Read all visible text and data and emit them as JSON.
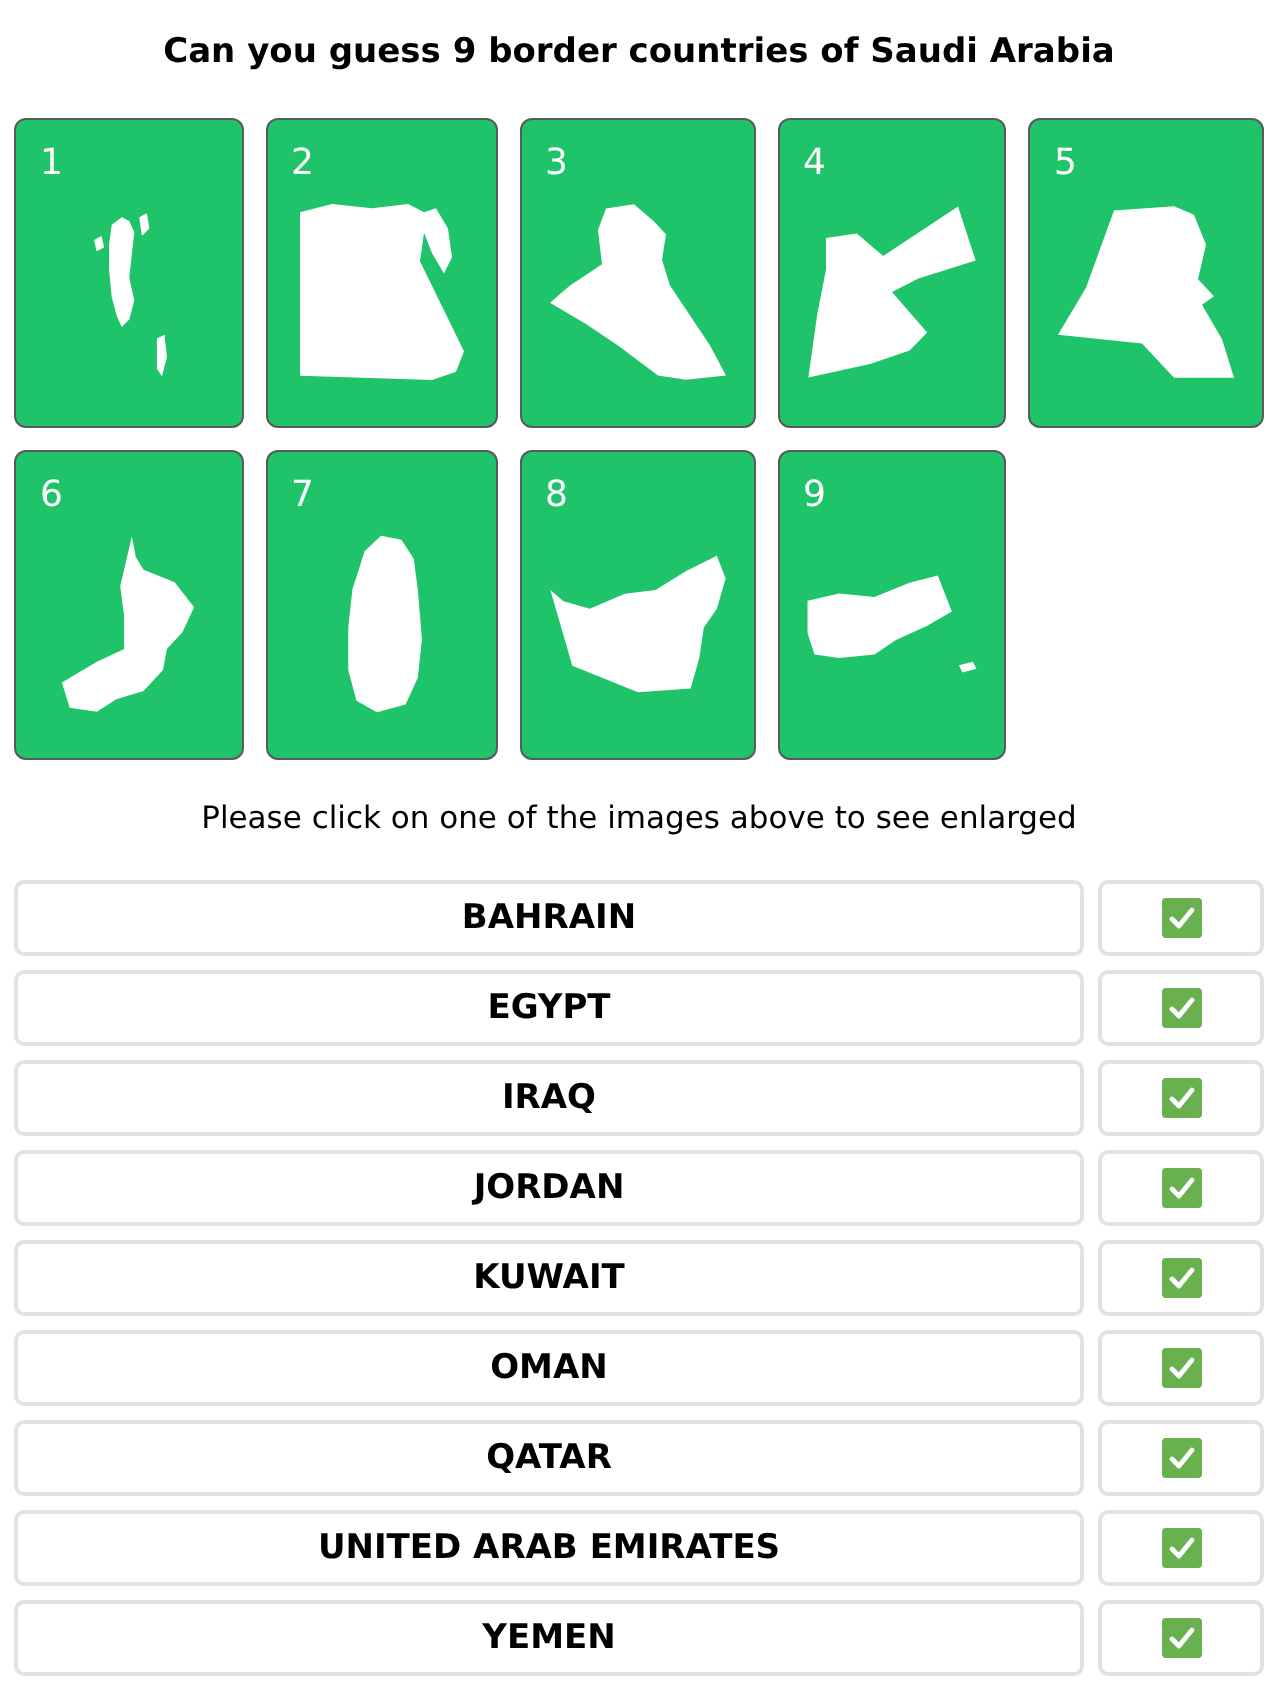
{
  "title": "Can you guess 9 border countries of Saudi Arabia",
  "cards": [
    {
      "number": "1"
    },
    {
      "number": "2"
    },
    {
      "number": "3"
    },
    {
      "number": "4"
    },
    {
      "number": "5"
    },
    {
      "number": "6"
    },
    {
      "number": "7"
    },
    {
      "number": "8"
    },
    {
      "number": "9"
    }
  ],
  "hint": "Please click on one of the images above to see enlarged",
  "answers": [
    {
      "name": "BAHRAIN",
      "checked": true
    },
    {
      "name": "EGYPT",
      "checked": true
    },
    {
      "name": "IRAQ",
      "checked": true
    },
    {
      "name": "JORDAN",
      "checked": true
    },
    {
      "name": "KUWAIT",
      "checked": true
    },
    {
      "name": "OMAN",
      "checked": true
    },
    {
      "name": "QATAR",
      "checked": true
    },
    {
      "name": "UNITED ARAB EMIRATES",
      "checked": true
    },
    {
      "name": "YEMEN",
      "checked": true
    }
  ]
}
